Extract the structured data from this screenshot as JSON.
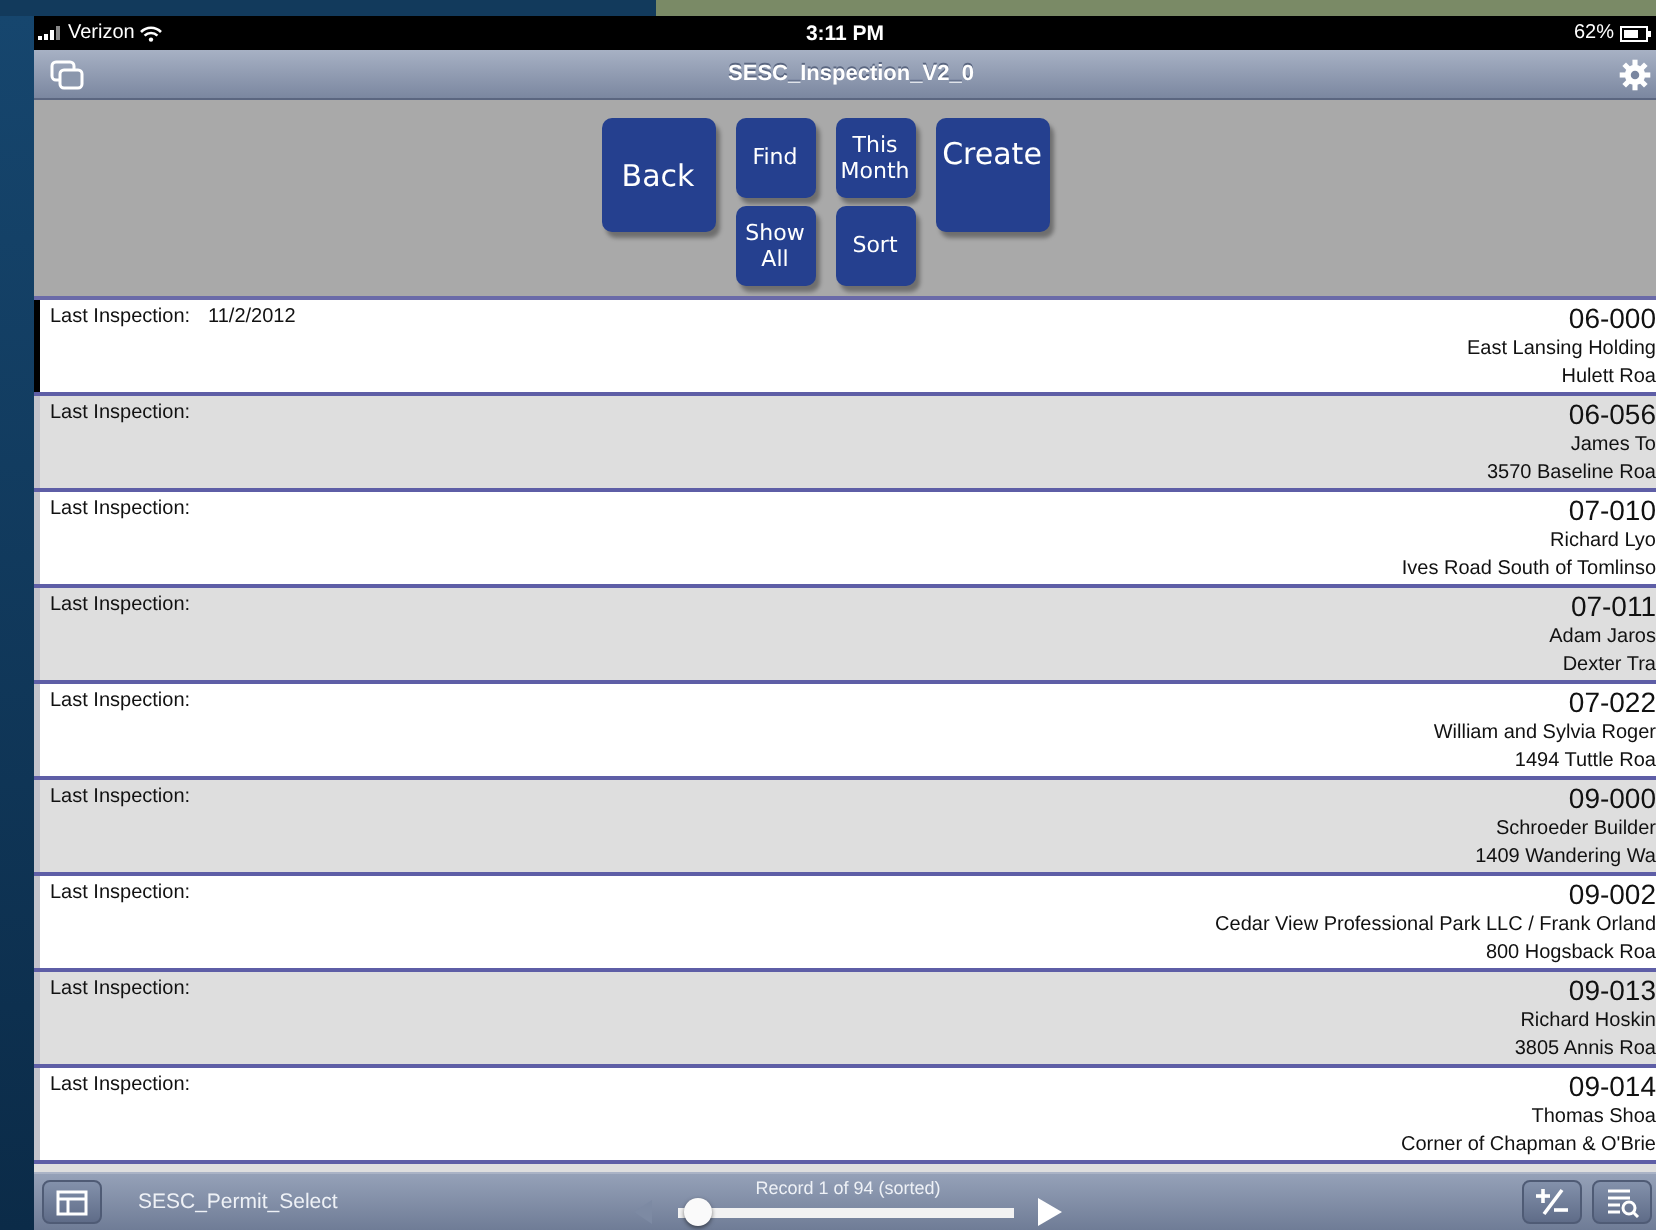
{
  "status_bar": {
    "carrier": "Verizon",
    "time": "3:11 PM",
    "battery": "62%"
  },
  "window": {
    "title": "SESC_Inspection_V2_0"
  },
  "buttons": [
    {
      "label": "Back",
      "kind": "large"
    },
    {
      "label": "Find",
      "kind": "small"
    },
    {
      "label": "Show All",
      "kind": "small"
    },
    {
      "label": "This Month",
      "kind": "small"
    },
    {
      "label": "Sort",
      "kind": "small"
    },
    {
      "label": "Create",
      "kind": "large"
    }
  ],
  "records": [
    {
      "label": "Last Inspection:",
      "date": "11/2/2012",
      "number": "06-000",
      "name": "East Lansing Holding",
      "address": "Hulett Roa",
      "selected": true
    },
    {
      "label": "Last Inspection:",
      "number": "06-056",
      "name": "James To",
      "address": "3570 Baseline Roa",
      "selected": false
    },
    {
      "label": "Last Inspection:",
      "number": "07-010",
      "name": "Richard Lyo",
      "address": "Ives Road South of Tomlinso",
      "selected": false
    },
    {
      "label": "Last Inspection:",
      "number": "07-011",
      "name": "Adam Jaros",
      "address": "Dexter Tra",
      "selected": false
    },
    {
      "label": "Last Inspection:",
      "number": "07-022",
      "name": "William and Sylvia Roger",
      "address": "1494 Tuttle Roa",
      "selected": false
    },
    {
      "label": "Last Inspection:",
      "number": "09-000",
      "name": "Schroeder Builder",
      "address": "1409 Wandering Wa",
      "selected": false
    },
    {
      "label": "Last Inspection:",
      "number": "09-002",
      "name": "Cedar View Professional Park LLC / Frank Orland",
      "address": "800 Hogsback Roa",
      "selected": false
    },
    {
      "label": "Last Inspection:",
      "number": "09-013",
      "name": "Richard Hoskin",
      "address": "3805 Annis Roa",
      "selected": false
    },
    {
      "label": "Last Inspection:",
      "number": "09-014",
      "name": "Thomas Shoa",
      "address": "Corner of Chapman & O'Brie",
      "selected": false
    }
  ],
  "bottom_toolbar": {
    "layout": "SESC_Permit_Select",
    "record_status": "Record 1 of 94 (sorted)",
    "slider": {
      "level": 0.02
    }
  }
}
